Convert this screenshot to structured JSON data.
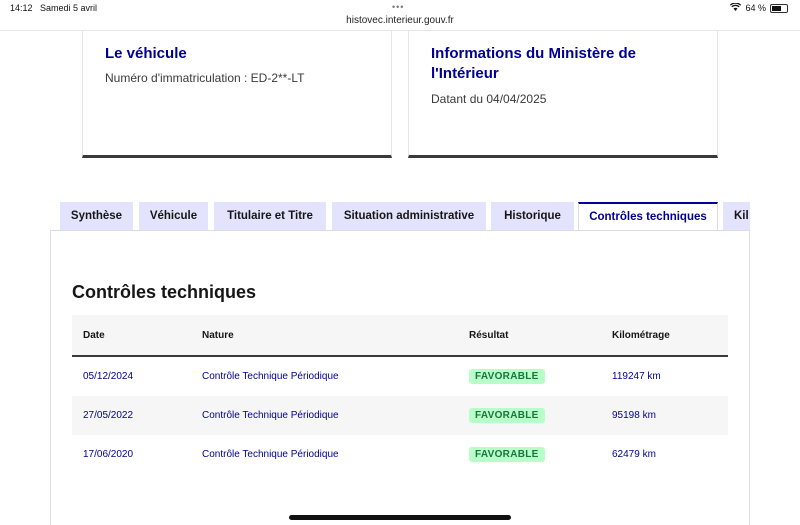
{
  "status_bar": {
    "time": "14:12",
    "date": "Samedi 5 avril",
    "battery": "64 %"
  },
  "browser": {
    "url": "histovec.interieur.gouv.fr"
  },
  "cards": {
    "vehicle": {
      "title": "Le véhicule",
      "text": "Numéro d'immatriculation : ED-2**-LT"
    },
    "ministry": {
      "title": "Informations du Ministère de l'Intérieur",
      "text": "Datant du 04/04/2025"
    }
  },
  "tabs": [
    {
      "label": "Synthèse",
      "active": false
    },
    {
      "label": "Véhicule",
      "active": false
    },
    {
      "label": "Titulaire et Titre",
      "active": false
    },
    {
      "label": "Situation administrative",
      "active": false
    },
    {
      "label": "Historique",
      "active": false
    },
    {
      "label": "Contrôles techniques",
      "active": true
    },
    {
      "label": "Kil",
      "active": false
    }
  ],
  "section": {
    "title": "Contrôles techniques",
    "columns": [
      "Date",
      "Nature",
      "Résultat",
      "Kilométrage"
    ],
    "rows": [
      {
        "date": "05/12/2024",
        "nature": "Contrôle Technique Périodique",
        "result": "FAVORABLE",
        "km": "119247 km"
      },
      {
        "date": "27/05/2022",
        "nature": "Contrôle Technique Périodique",
        "result": "FAVORABLE",
        "km": "95198 km"
      },
      {
        "date": "17/06/2020",
        "nature": "Contrôle Technique Périodique",
        "result": "FAVORABLE",
        "km": "62479 km"
      }
    ]
  },
  "colors": {
    "primary": "#000091",
    "tab_bg": "#e3e3fd",
    "badge_bg": "#b8fec9",
    "badge_text": "#18753c"
  }
}
